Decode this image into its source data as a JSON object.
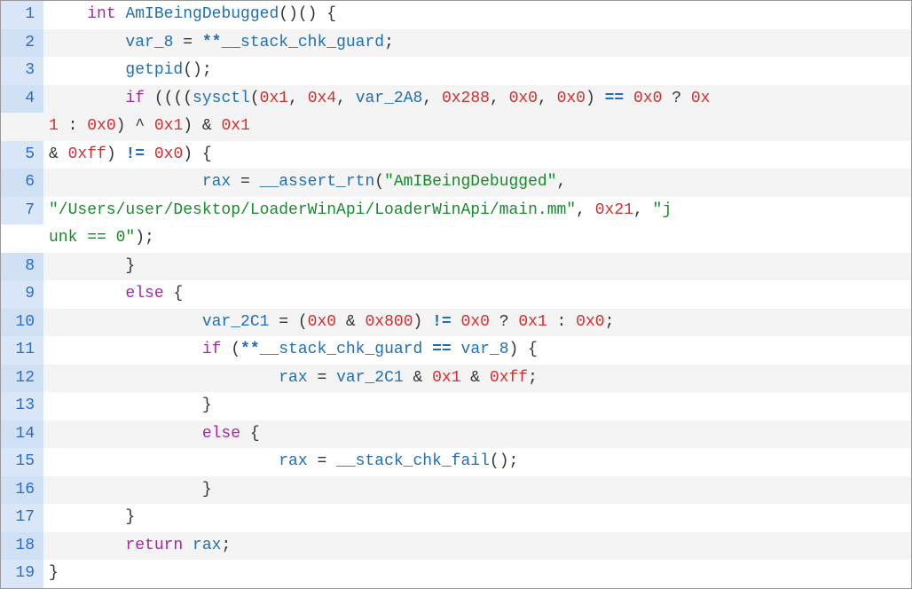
{
  "chart_data": {
    "type": "table",
    "title": "Decompiled function AmIBeingDebugged",
    "language": "C / pseudocode",
    "lines": [
      {
        "n": 1,
        "text": "int AmIBeingDebugged()() {"
      },
      {
        "n": 2,
        "text": "    var_8 = **__stack_chk_guard;"
      },
      {
        "n": 3,
        "text": "    getpid();"
      },
      {
        "n": 4,
        "text": "    if ((((sysctl(0x1, 0x4, var_2A8, 0x288, 0x0, 0x0) == 0x0 ? 0x1 : 0x0) ^ 0x1) & 0x1 "
      },
      {
        "n": 5,
        "text": "& 0xff) != 0x0) {"
      },
      {
        "n": 6,
        "text": "            rax = __assert_rtn(\"AmIBeingDebugged\","
      },
      {
        "n": 7,
        "text": "\"/Users/user/Desktop/LoaderWinApi/LoaderWinApi/main.mm\", 0x21, \"junk == 0\");"
      },
      {
        "n": 8,
        "text": "    }"
      },
      {
        "n": 9,
        "text": "    else {"
      },
      {
        "n": 10,
        "text": "            var_2C1 = (0x0 & 0x800) != 0x0 ? 0x1 : 0x0;"
      },
      {
        "n": 11,
        "text": "            if (**__stack_chk_guard == var_8) {"
      },
      {
        "n": 12,
        "text": "                    rax = var_2C1 & 0x1 & 0xff;"
      },
      {
        "n": 13,
        "text": "            }"
      },
      {
        "n": 14,
        "text": "            else {"
      },
      {
        "n": 15,
        "text": "                    rax = __stack_chk_fail();"
      },
      {
        "n": 16,
        "text": "            }"
      },
      {
        "n": 17,
        "text": "    }"
      },
      {
        "n": 18,
        "text": "    return rax;"
      },
      {
        "n": 19,
        "text": "}"
      }
    ]
  },
  "lines": {
    "l1": "1",
    "l2": "2",
    "l3": "3",
    "l4": "4",
    "l5": "5",
    "l6": "6",
    "l7": "7",
    "l8": "8",
    "l9": "9",
    "l10": "10",
    "l11": "11",
    "l12": "12",
    "l13": "13",
    "l14": "14",
    "l15": "15",
    "l16": "16",
    "l17": "17",
    "l18": "18",
    "l19": "19"
  },
  "t": {
    "int": "int",
    "fn_name": "AmIBeingDebugged",
    "parens2": "()()",
    "space": " ",
    "lbrace": " {",
    "rbrace": "}",
    "ind1": "    ",
    "ind2": "            ",
    "ind3": "                    ",
    "var_8": "var_8",
    "eq": " = ",
    "dblstar": "**",
    "stack_guard": "__stack_chk_guard",
    "semi": ";",
    "getpid": "getpid",
    "call_empty": "();",
    "if": "if",
    "else": "else",
    "return": "return",
    "rax": "rax",
    "sysctl": "sysctl",
    "lparen4": " ((((",
    "lparen": "(",
    "rparen": ")",
    "comma": ", ",
    "n0x1": "0x1",
    "n0x4": "0x4",
    "var_2A8": "var_2A8",
    "n0x288": "0x288",
    "n0x0": "0x0",
    "n0xff": "0xff",
    "n0x800": "0x800",
    "n0x21": "0x21",
    "opeq": " == ",
    "opne": " != ",
    "tern_q": " ? ",
    "tern_c": " : ",
    "n0x": "0x",
    "one": "1",
    "caret": " ^ ",
    "amp": " & ",
    "rparen_brace": ") {",
    "ampstart": "& ",
    "assert_rtn": "__assert_rtn",
    "str_fnname": "\"AmIBeingDebugged\"",
    "wrap_cont": "",
    "str_path_a": "\"/Users/user/Desktop/LoaderWinApi/LoaderWinApi/main.mm\"",
    "str_j_a": "\"j",
    "str_j_b": "unk == 0\"",
    "close_call": ");",
    "var_2C1": "var_2C1",
    "lparen1": " (",
    "stack_fail": "__stack_chk_fail",
    "trailing_comma": ","
  }
}
